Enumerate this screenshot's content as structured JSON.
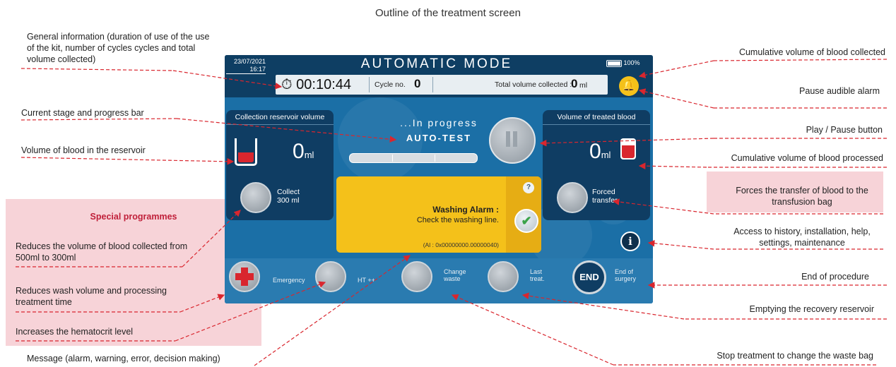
{
  "title": "Outline of the treatment screen",
  "annotations_left": {
    "general_info": "General information (duration of use of the use of the kit, number of cycles cycles and total volume collected)",
    "current_stage": "Current stage and progress bar",
    "volume_reservoir": "Volume of blood in the reservoir",
    "special_programmes": "Special programmes",
    "reduces_volume": "Reduces the volume of blood collected from 500ml to 300ml",
    "reduces_wash": "Reduces wash volume and processing treatment time",
    "increases_hct": "Increases the hematocrit level",
    "message": "Message (alarm, warning, error, decision making)"
  },
  "annotations_right": {
    "cumulative_collected": "Cumulative volume of blood collected",
    "pause_alarm": "Pause audible alarm",
    "play_pause": "Play / Pause button",
    "cumulative_processed": "Cumulative volume of blood processed",
    "forces_transfer": "Forces the transfer of blood to the transfusion bag",
    "access_history": "Access to history, installation, help, settings, maintenance",
    "end_procedure": "End of procedure",
    "emptying": "Emptying the recovery reservoir",
    "stop_treatment": "Stop treatment to change the waste bag"
  },
  "screen": {
    "date": "23/07/2021",
    "time": "16:17",
    "mode": "AUTOMATIC MODE",
    "battery": "100%",
    "timer": "00:10:44",
    "cycle_label": "Cycle no.",
    "cycle_value": "0",
    "total_label": "Total volume collected :",
    "total_value": "0",
    "total_unit": "ml",
    "left_panel_title": "Collection reservoir volume",
    "left_value": "0",
    "unit": "ml",
    "collect_label": "Collect 300 ml",
    "right_panel_title": "Volume of treated blood",
    "right_value": "0",
    "forced_label": "Forced transfer",
    "status": "...In progress",
    "stage": "AUTO-TEST",
    "progress": 0.0,
    "alarm_title": "Washing Alarm :",
    "alarm_msg": "Check the washing line.",
    "alarm_code": "(Al : 0x00000000.00000040)",
    "help_glyph": "?",
    "check_glyph": "✔",
    "info_glyph": "i",
    "bottom": {
      "emergency": "Emergency",
      "ht": "HT ++",
      "change_waste": "Change waste",
      "last_treat": "Last treat.",
      "end_btn": "END",
      "end_label": "End of surgery"
    }
  },
  "colors": {
    "screen": "#1b6fa6",
    "panel": "#0f3d63",
    "alarm": "#f4c11a",
    "annotation_line": "#d9262e",
    "pink_box": "#f7d3d8"
  }
}
